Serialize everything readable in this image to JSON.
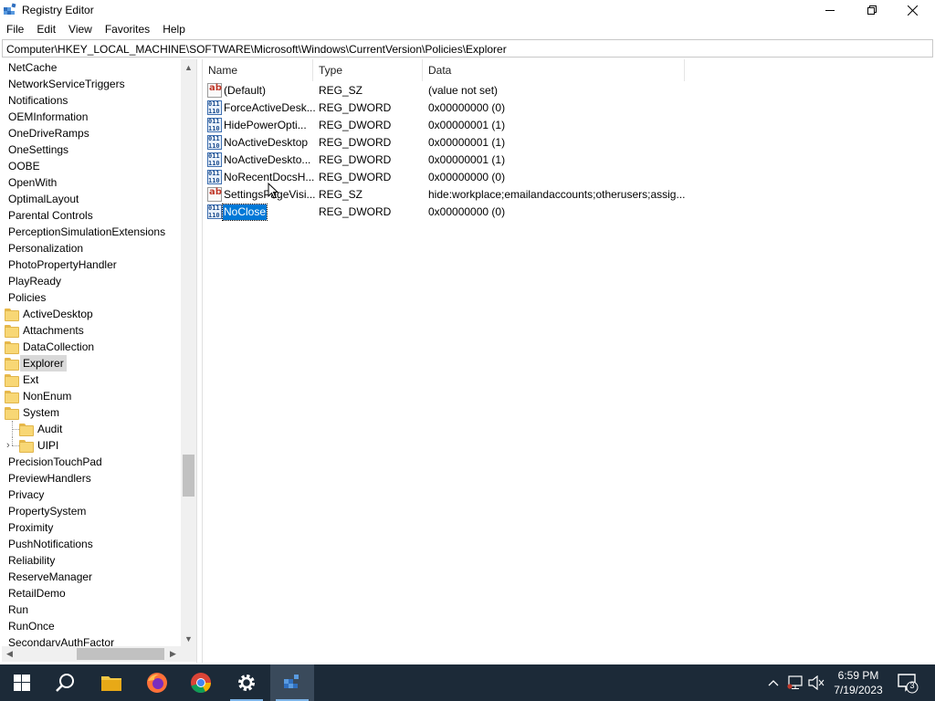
{
  "window": {
    "title": "Registry Editor",
    "minimize_icon": "minimize-icon",
    "maximize_icon": "restore-icon",
    "close_icon": "close-icon"
  },
  "menu": [
    "File",
    "Edit",
    "View",
    "Favorites",
    "Help"
  ],
  "address": "Computer\\HKEY_LOCAL_MACHINE\\SOFTWARE\\Microsoft\\Windows\\CurrentVersion\\Policies\\Explorer",
  "tree": [
    {
      "label": "NetCache",
      "level": 0
    },
    {
      "label": "NetworkServiceTriggers",
      "level": 0
    },
    {
      "label": "Notifications",
      "level": 0
    },
    {
      "label": "OEMInformation",
      "level": 0
    },
    {
      "label": "OneDriveRamps",
      "level": 0
    },
    {
      "label": "OneSettings",
      "level": 0
    },
    {
      "label": "OOBE",
      "level": 0
    },
    {
      "label": "OpenWith",
      "level": 0
    },
    {
      "label": "OptimalLayout",
      "level": 0
    },
    {
      "label": "Parental Controls",
      "level": 0
    },
    {
      "label": "PerceptionSimulationExtensions",
      "level": 0
    },
    {
      "label": "Personalization",
      "level": 0
    },
    {
      "label": "PhotoPropertyHandler",
      "level": 0
    },
    {
      "label": "PlayReady",
      "level": 0
    },
    {
      "label": "Policies",
      "level": 0
    },
    {
      "label": "ActiveDesktop",
      "level": 1
    },
    {
      "label": "Attachments",
      "level": 1
    },
    {
      "label": "DataCollection",
      "level": 1
    },
    {
      "label": "Explorer",
      "level": 1,
      "selected": true
    },
    {
      "label": "Ext",
      "level": 1
    },
    {
      "label": "NonEnum",
      "level": 1
    },
    {
      "label": "System",
      "level": 1
    },
    {
      "label": "Audit",
      "level": 2
    },
    {
      "label": "UIPI",
      "level": 2,
      "expandable": true
    },
    {
      "label": "PrecisionTouchPad",
      "level": 0
    },
    {
      "label": "PreviewHandlers",
      "level": 0
    },
    {
      "label": "Privacy",
      "level": 0
    },
    {
      "label": "PropertySystem",
      "level": 0
    },
    {
      "label": "Proximity",
      "level": 0
    },
    {
      "label": "PushNotifications",
      "level": 0
    },
    {
      "label": "Reliability",
      "level": 0
    },
    {
      "label": "ReserveManager",
      "level": 0
    },
    {
      "label": "RetailDemo",
      "level": 0
    },
    {
      "label": "Run",
      "level": 0
    },
    {
      "label": "RunOnce",
      "level": 0
    },
    {
      "label": "SecondarvAuthFactor",
      "level": 0
    }
  ],
  "columns": {
    "name": "Name",
    "type": "Type",
    "data": "Data"
  },
  "values": [
    {
      "name": "(Default)",
      "type": "REG_SZ",
      "data": "(value not set)",
      "icon": "string-value-icon"
    },
    {
      "name": "ForceActiveDesk...",
      "type": "REG_DWORD",
      "data": "0x00000000 (0)",
      "icon": "binary-value-icon"
    },
    {
      "name": "HidePowerOpti...",
      "type": "REG_DWORD",
      "data": "0x00000001 (1)",
      "icon": "binary-value-icon"
    },
    {
      "name": "NoActiveDesktop",
      "type": "REG_DWORD",
      "data": "0x00000001 (1)",
      "icon": "binary-value-icon"
    },
    {
      "name": "NoActiveDeskto...",
      "type": "REG_DWORD",
      "data": "0x00000001 (1)",
      "icon": "binary-value-icon"
    },
    {
      "name": "NoRecentDocsH...",
      "type": "REG_DWORD",
      "data": "0x00000000 (0)",
      "icon": "binary-value-icon"
    },
    {
      "name": "SettingsPageVisi...",
      "type": "REG_SZ",
      "data": "hide:workplace;emailandaccounts;otherusers;assig...",
      "icon": "string-value-icon"
    },
    {
      "name": "NoClose",
      "type": "REG_DWORD",
      "data": "0x00000000 (0)",
      "icon": "binary-value-icon",
      "selected": true
    }
  ],
  "taskbar": {
    "apps": [
      "start-icon",
      "search-icon",
      "file-explorer-icon",
      "firefox-icon",
      "chrome-icon",
      "settings-icon",
      "registry-editor-icon"
    ],
    "clock_time": "6:59 PM",
    "clock_date": "7/19/2023",
    "notification_count": "3"
  },
  "colors": {
    "selection": "#0078d7",
    "taskbar": "#1c2a38"
  }
}
